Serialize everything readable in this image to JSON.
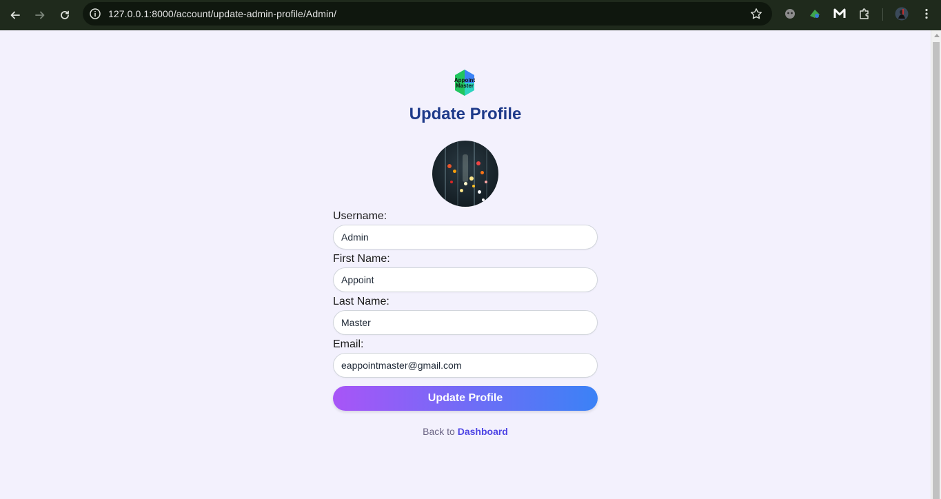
{
  "browser": {
    "url": "127.0.0.1:8000/account/update-admin-profile/Admin/"
  },
  "colors": {
    "page_bg": "#f3f1fd",
    "title": "#1e3a8a",
    "button_gradient_start": "#a855f7",
    "button_gradient_end": "#3b82f6",
    "link": "#4f46e5"
  },
  "logo": {
    "text_line1": "Appoint",
    "text_line2": "Master"
  },
  "page": {
    "title": "Update Profile"
  },
  "form": {
    "username_label": "Username:",
    "username_value": "Admin",
    "first_name_label": "First Name:",
    "first_name_value": "Appoint",
    "last_name_label": "Last Name:",
    "last_name_value": "Master",
    "email_label": "Email:",
    "email_value": "eappointmaster@gmail.com",
    "submit_label": "Update Profile"
  },
  "footer": {
    "back_text": "Back to ",
    "dashboard_link": "Dashboard"
  }
}
